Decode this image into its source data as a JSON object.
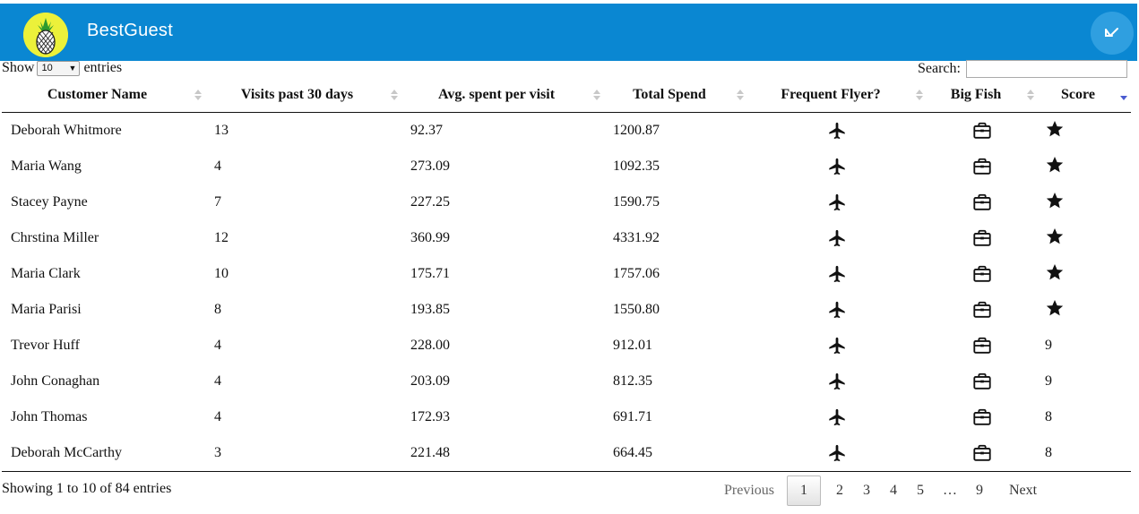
{
  "app": {
    "title": "BestGuest",
    "brand_color": "#0a87d2",
    "logo_bg": "#ecf13a"
  },
  "controls": {
    "show_label": "Show",
    "page_length": "10",
    "entries_label": "entries",
    "search_label": "Search:",
    "search_value": ""
  },
  "table": {
    "columns": [
      {
        "label": "Customer Name",
        "sort": "both"
      },
      {
        "label": "Visits past 30 days",
        "sort": "both"
      },
      {
        "label": "Avg. spent per visit",
        "sort": "both"
      },
      {
        "label": "Total Spend",
        "sort": "both"
      },
      {
        "label": "Frequent Flyer?",
        "sort": "both"
      },
      {
        "label": "Big Fish",
        "sort": "both"
      },
      {
        "label": "Score",
        "sort": "desc"
      }
    ],
    "rows": [
      {
        "name": "Deborah Whitmore",
        "visits": "13",
        "avg": "92.37",
        "total": "1200.87",
        "flyer": "plane-icon",
        "fish": "briefcase-icon",
        "score": "",
        "score_icon": "star-icon"
      },
      {
        "name": "Maria Wang",
        "visits": "4",
        "avg": "273.09",
        "total": "1092.35",
        "flyer": "plane-icon",
        "fish": "briefcase-icon",
        "score": "",
        "score_icon": "star-icon"
      },
      {
        "name": "Stacey Payne",
        "visits": "7",
        "avg": "227.25",
        "total": "1590.75",
        "flyer": "plane-icon",
        "fish": "briefcase-icon",
        "score": "",
        "score_icon": "star-icon"
      },
      {
        "name": "Chrstina Miller",
        "visits": "12",
        "avg": "360.99",
        "total": "4331.92",
        "flyer": "plane-icon",
        "fish": "briefcase-icon",
        "score": "",
        "score_icon": "star-icon"
      },
      {
        "name": "Maria Clark",
        "visits": "10",
        "avg": "175.71",
        "total": "1757.06",
        "flyer": "plane-icon",
        "fish": "briefcase-icon",
        "score": "",
        "score_icon": "star-icon"
      },
      {
        "name": "Maria Parisi",
        "visits": "8",
        "avg": "193.85",
        "total": "1550.80",
        "flyer": "plane-icon",
        "fish": "briefcase-icon",
        "score": "",
        "score_icon": "star-icon"
      },
      {
        "name": "Trevor Huff",
        "visits": "4",
        "avg": "228.00",
        "total": "912.01",
        "flyer": "plane-icon",
        "fish": "briefcase-icon",
        "score": "9",
        "score_icon": ""
      },
      {
        "name": "John Conaghan",
        "visits": "4",
        "avg": "203.09",
        "total": "812.35",
        "flyer": "plane-icon",
        "fish": "briefcase-icon",
        "score": "9",
        "score_icon": ""
      },
      {
        "name": "John Thomas",
        "visits": "4",
        "avg": "172.93",
        "total": "691.71",
        "flyer": "plane-icon",
        "fish": "briefcase-icon",
        "score": "8",
        "score_icon": ""
      },
      {
        "name": "Deborah McCarthy",
        "visits": "3",
        "avg": "221.48",
        "total": "664.45",
        "flyer": "plane-icon",
        "fish": "briefcase-icon",
        "score": "8",
        "score_icon": ""
      }
    ]
  },
  "footer": {
    "info": "Showing 1 to 10 of 84 entries",
    "previous": "Previous",
    "pages": [
      "1",
      "2",
      "3",
      "4",
      "5",
      "…",
      "9"
    ],
    "current_page": "1",
    "next": "Next"
  }
}
